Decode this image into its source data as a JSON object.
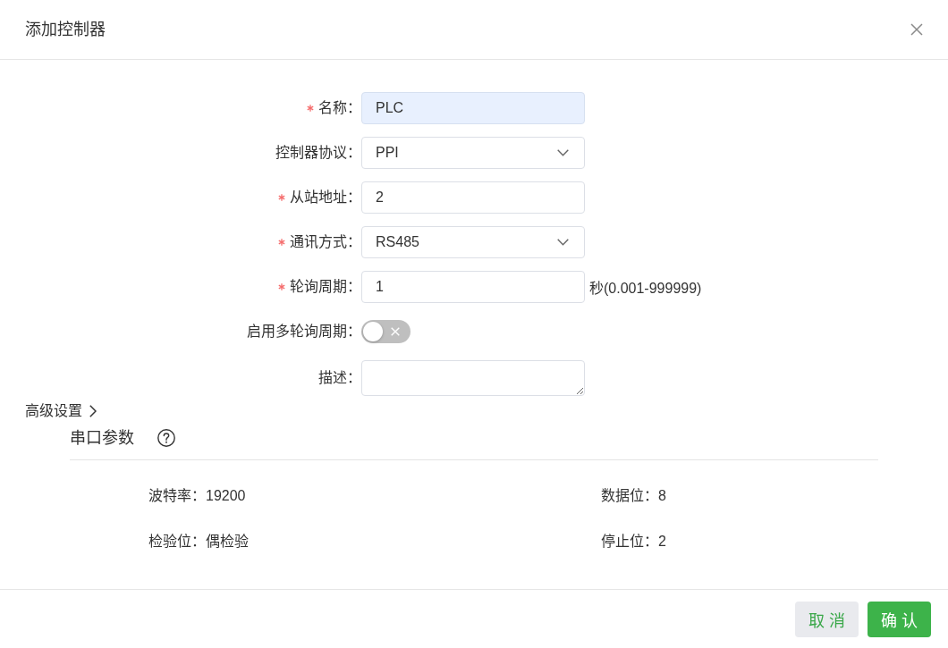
{
  "dialog": {
    "title": "添加控制器"
  },
  "form": {
    "fields": [
      {
        "kind": "input",
        "label": "名称：",
        "required": true,
        "value": "PLC",
        "autofilled": true
      },
      {
        "kind": "select",
        "label": "控制器协议：",
        "required": false,
        "value": "PPI"
      },
      {
        "kind": "input",
        "label": "从站地址：",
        "required": true,
        "value": "2",
        "autofilled": false
      },
      {
        "kind": "select",
        "label": "通讯方式：",
        "required": true,
        "value": "RS485"
      },
      {
        "kind": "input",
        "label": "轮询周期：",
        "required": true,
        "value": "1",
        "autofilled": false,
        "suffix": "秒(0.001-999999)"
      },
      {
        "kind": "switch",
        "label": "启用多轮询周期：",
        "required": false,
        "on": false
      },
      {
        "kind": "textarea",
        "label": "描述：",
        "required": false
      }
    ]
  },
  "advanced": {
    "label": "高级设置",
    "expanded": false
  },
  "serial_params": {
    "title": "串口参数",
    "items": [
      {
        "label": "波特率：",
        "value": "19200"
      },
      {
        "label": "数据位：",
        "value": "8"
      },
      {
        "label": "检验位：",
        "value": "偶检验"
      },
      {
        "label": "停止位：",
        "value": "2"
      }
    ]
  },
  "footer": {
    "buttons": [
      {
        "kind": "secondary",
        "label": "取 消"
      },
      {
        "kind": "primary",
        "label": "确 认"
      }
    ]
  }
}
